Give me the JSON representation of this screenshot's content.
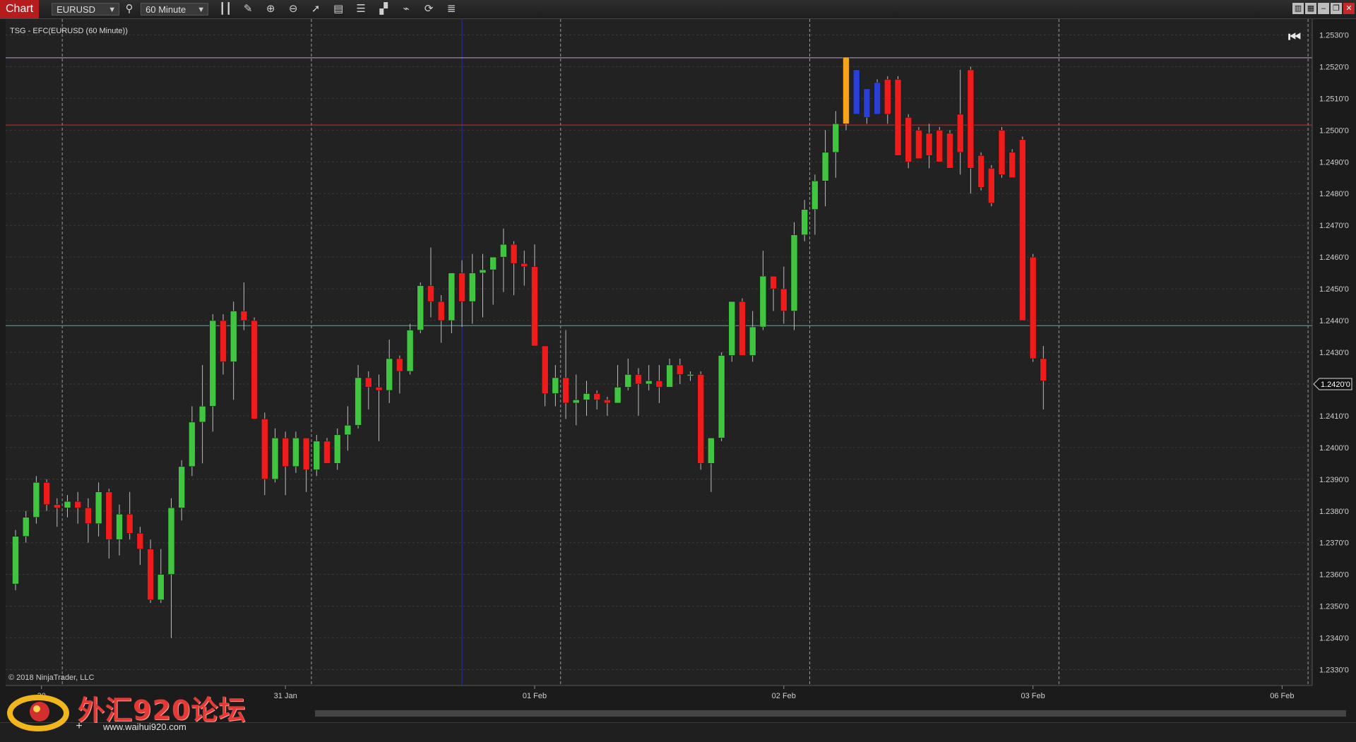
{
  "toolbar": {
    "chart_tab": "Chart",
    "instrument": "EURUSD",
    "interval": "60 Minute"
  },
  "chart": {
    "indicator_label": "TSG - EFC(EURUSD (60 Minute))",
    "copyright": "© 2018 NinjaTrader, LLC",
    "price_marker": "1.2420'0"
  },
  "watermark": {
    "logo_text": "外汇920论坛",
    "url": "www.waihui920.com"
  },
  "colors": {
    "background": "#222222",
    "grid": "#3a3a3a",
    "up": "#3fc53f",
    "down": "#f01c1c",
    "neutral": "#2a3fd6",
    "highlight": "#f7a21b",
    "line_purple": "#c79be0",
    "line_red": "#e02424",
    "line_teal": "#3fb8b0",
    "session_line": "#bbbbbb",
    "blue_divider": "#2a2ab0"
  },
  "chart_data": {
    "type": "candlestick",
    "y_axis": {
      "min": 1.2325,
      "max": 1.2535,
      "ticks": [
        "1.2330'0",
        "1.2340'0",
        "1.2350'0",
        "1.2360'0",
        "1.2370'0",
        "1.2380'0",
        "1.2390'0",
        "1.2400'0",
        "1.2410'0",
        "1.2420'0",
        "1.2430'0",
        "1.2440'0",
        "1.2450'0",
        "1.2460'0",
        "1.2470'0",
        "1.2480'0",
        "1.2490'0",
        "1.2500'0",
        "1.2510'0",
        "1.2520'0",
        "1.2530'0"
      ],
      "tick_values": [
        1.233,
        1.234,
        1.235,
        1.236,
        1.237,
        1.238,
        1.239,
        1.24,
        1.241,
        1.242,
        1.243,
        1.244,
        1.245,
        1.246,
        1.247,
        1.248,
        1.249,
        1.25,
        1.251,
        1.252,
        1.253
      ]
    },
    "x_axis": {
      "labels": [
        {
          "text": "30",
          "index": 2.5
        },
        {
          "text": "31 Jan",
          "index": 26
        },
        {
          "text": "01 Feb",
          "index": 50
        },
        {
          "text": "02 Feb",
          "index": 74
        },
        {
          "text": "03 Feb",
          "index": 98
        },
        {
          "text": "06 Feb",
          "index": 122
        }
      ],
      "bar_count": 127
    },
    "horizontal_lines": [
      {
        "value": 1.25228,
        "color": "line_purple"
      },
      {
        "value": 1.25016,
        "color": "line_red"
      },
      {
        "value": 1.24384,
        "color": "line_teal"
      }
    ],
    "session_lines": [
      4.5,
      28.5,
      52.5,
      76.5,
      100.5,
      124.5
    ],
    "blue_divider_index": 43,
    "candles": [
      [
        1.2357,
        1.2374,
        1.2355,
        1.2372
      ],
      [
        1.2372,
        1.238,
        1.237,
        1.2378
      ],
      [
        1.2378,
        1.2391,
        1.2376,
        1.2389
      ],
      [
        1.2389,
        1.239,
        1.238,
        1.2382
      ],
      [
        1.2382,
        1.2384,
        1.2375,
        1.2381
      ],
      [
        1.2381,
        1.2385,
        1.2378,
        1.2383
      ],
      [
        1.2383,
        1.2386,
        1.2376,
        1.2381
      ],
      [
        1.2381,
        1.2384,
        1.237,
        1.2376
      ],
      [
        1.2376,
        1.2389,
        1.2372,
        1.2386
      ],
      [
        1.2386,
        1.2387,
        1.2365,
        1.2371
      ],
      [
        1.2371,
        1.2382,
        1.2366,
        1.2379
      ],
      [
        1.2379,
        1.2386,
        1.2371,
        1.2373
      ],
      [
        1.2373,
        1.2375,
        1.2363,
        1.2368
      ],
      [
        1.2368,
        1.2371,
        1.2351,
        1.2352
      ],
      [
        1.2352,
        1.2368,
        1.2351,
        1.236
      ],
      [
        1.236,
        1.2384,
        1.234,
        1.2381
      ],
      [
        1.2381,
        1.2396,
        1.2377,
        1.2394
      ],
      [
        1.2394,
        1.2413,
        1.2391,
        1.2408
      ],
      [
        1.2408,
        1.2426,
        1.2395,
        1.2413
      ],
      [
        1.2413,
        1.2442,
        1.2405,
        1.244
      ],
      [
        1.244,
        1.2442,
        1.2423,
        1.2427
      ],
      [
        1.2427,
        1.2446,
        1.2415,
        1.2443
      ],
      [
        1.2443,
        1.2452,
        1.2437,
        1.244
      ],
      [
        1.244,
        1.2441,
        1.2409,
        1.2409
      ],
      [
        1.2409,
        1.2411,
        1.2385,
        1.239
      ],
      [
        1.239,
        1.2406,
        1.2389,
        1.2403
      ],
      [
        1.2403,
        1.2405,
        1.2385,
        1.2394
      ],
      [
        1.2394,
        1.2405,
        1.2392,
        1.2403
      ],
      [
        1.2403,
        1.2403,
        1.2386,
        1.2393
      ],
      [
        1.2393,
        1.2404,
        1.2391,
        1.2402
      ],
      [
        1.2402,
        1.2403,
        1.2395,
        1.2395
      ],
      [
        1.2395,
        1.2406,
        1.2393,
        1.2404
      ],
      [
        1.2404,
        1.2413,
        1.2399,
        1.2407
      ],
      [
        1.2407,
        1.2426,
        1.2406,
        1.2422
      ],
      [
        1.2422,
        1.2424,
        1.2412,
        1.2419
      ],
      [
        1.2419,
        1.2423,
        1.2402,
        1.2418
      ],
      [
        1.2418,
        1.2434,
        1.2414,
        1.2428
      ],
      [
        1.2428,
        1.2429,
        1.2417,
        1.2424
      ],
      [
        1.2424,
        1.2439,
        1.2423,
        1.2437
      ],
      [
        1.2437,
        1.2452,
        1.2436,
        1.2451
      ],
      [
        1.2451,
        1.2463,
        1.2441,
        1.2446
      ],
      [
        1.2446,
        1.2448,
        1.2433,
        1.244
      ],
      [
        1.244,
        1.2454,
        1.2436,
        1.2455
      ],
      [
        1.2455,
        1.2459,
        1.2438,
        1.2446
      ],
      [
        1.2446,
        1.2461,
        1.2439,
        1.2455
      ],
      [
        1.2455,
        1.2461,
        1.2441,
        1.2456
      ],
      [
        1.2456,
        1.246,
        1.2445,
        1.246
      ],
      [
        1.246,
        1.2469,
        1.2449,
        1.2464
      ],
      [
        1.2464,
        1.2465,
        1.2448,
        1.2458
      ],
      [
        1.2458,
        1.2462,
        1.2451,
        1.2457
      ],
      [
        1.2457,
        1.2464,
        1.2434,
        1.2432
      ],
      [
        1.2432,
        1.2432,
        1.2413,
        1.2417
      ],
      [
        1.2417,
        1.2426,
        1.2413,
        1.2422
      ],
      [
        1.2422,
        1.2437,
        1.2409,
        1.2414
      ],
      [
        1.2414,
        1.2423,
        1.2407,
        1.2415
      ],
      [
        1.2415,
        1.2421,
        1.241,
        1.2417
      ],
      [
        1.2417,
        1.2418,
        1.2412,
        1.2415
      ],
      [
        1.2415,
        1.2416,
        1.241,
        1.2414
      ],
      [
        1.2414,
        1.2426,
        1.2414,
        1.2419
      ],
      [
        1.2419,
        1.2428,
        1.2418,
        1.2423
      ],
      [
        1.2423,
        1.2425,
        1.241,
        1.242
      ],
      [
        1.242,
        1.2426,
        1.2418,
        1.2421
      ],
      [
        1.2421,
        1.2426,
        1.2414,
        1.2419
      ],
      [
        1.2419,
        1.2428,
        1.2419,
        1.2426
      ],
      [
        1.2426,
        1.2428,
        1.242,
        1.2423
      ],
      [
        1.2423,
        1.2424,
        1.2421,
        1.2423
      ],
      [
        1.2423,
        1.2424,
        1.2393,
        1.2395
      ],
      [
        1.2395,
        1.2396,
        1.2386,
        1.2403
      ],
      [
        1.2403,
        1.243,
        1.2402,
        1.2429
      ],
      [
        1.2429,
        1.2446,
        1.2427,
        1.2446
      ],
      [
        1.2446,
        1.2447,
        1.2429,
        1.2429
      ],
      [
        1.2429,
        1.2443,
        1.2427,
        1.2438
      ],
      [
        1.2438,
        1.2462,
        1.2437,
        1.2454
      ],
      [
        1.2454,
        1.2452,
        1.2443,
        1.245
      ],
      [
        1.245,
        1.2457,
        1.2439,
        1.2443
      ],
      [
        1.2443,
        1.2471,
        1.2437,
        1.2467
      ],
      [
        1.2467,
        1.2478,
        1.2465,
        1.2475
      ],
      [
        1.2475,
        1.2486,
        1.2467,
        1.2484
      ],
      [
        1.2484,
        1.25,
        1.2476,
        1.2493
      ],
      [
        1.2493,
        1.2506,
        1.2485,
        1.2502
      ],
      [
        1.2502,
        1.2523,
        1.25,
        1.2523
      ],
      [
        1.2505,
        1.2519,
        1.2505,
        1.2519
      ],
      [
        1.2504,
        1.2513,
        1.2502,
        1.2513
      ],
      [
        1.2515,
        1.2516,
        1.2505,
        1.2505
      ],
      [
        1.2516,
        1.2517,
        1.2502,
        1.2505
      ],
      [
        1.2516,
        1.2517,
        1.2492,
        1.2492
      ],
      [
        1.2504,
        1.2505,
        1.2488,
        1.249
      ],
      [
        1.25,
        1.2501,
        1.2491,
        1.2491
      ],
      [
        1.2499,
        1.2502,
        1.2488,
        1.2492
      ],
      [
        1.25,
        1.2501,
        1.249,
        1.249
      ],
      [
        1.2499,
        1.25,
        1.2489,
        1.2488
      ],
      [
        1.2505,
        1.2519,
        1.2486,
        1.2493
      ],
      [
        1.2519,
        1.252,
        1.248,
        1.2488
      ],
      [
        1.2492,
        1.2493,
        1.2481,
        1.2482
      ],
      [
        1.2488,
        1.2489,
        1.2476,
        1.2477
      ],
      [
        1.25,
        1.2501,
        1.2485,
        1.2486
      ],
      [
        1.2493,
        1.2494,
        1.2486,
        1.2485
      ],
      [
        1.2497,
        1.2498,
        1.244,
        1.244
      ],
      [
        1.246,
        1.2461,
        1.2427,
        1.2428
      ],
      [
        1.2428,
        1.2432,
        1.2412,
        1.2421
      ]
    ]
  }
}
